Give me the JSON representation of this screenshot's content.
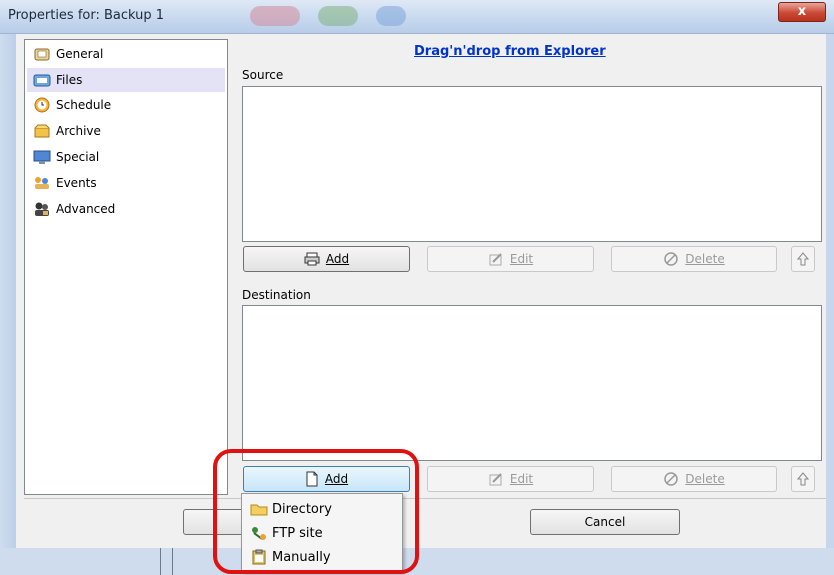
{
  "window": {
    "title": "Properties for: Backup 1",
    "close_label": "x"
  },
  "nav": {
    "items": [
      {
        "label": "General",
        "icon": "general-icon"
      },
      {
        "label": "Files",
        "icon": "files-icon",
        "selected": true
      },
      {
        "label": "Schedule",
        "icon": "schedule-icon"
      },
      {
        "label": "Archive",
        "icon": "archive-icon"
      },
      {
        "label": "Special",
        "icon": "special-icon"
      },
      {
        "label": "Events",
        "icon": "events-icon"
      },
      {
        "label": "Advanced",
        "icon": "advanced-icon"
      }
    ]
  },
  "files": {
    "dragdrop_link": "Drag'n'drop from Explorer",
    "source": {
      "label": "Source",
      "add_label": "Add",
      "edit_label": "Edit",
      "delete_label": "Delete"
    },
    "destination": {
      "label": "Destination",
      "add_label": "Add",
      "edit_label": "Edit",
      "delete_label": "Delete"
    }
  },
  "dialog": {
    "cancel_label": "Cancel"
  },
  "add_menu": {
    "items": [
      {
        "label": "Directory",
        "icon": "folder-icon"
      },
      {
        "label": "FTP site",
        "icon": "ftp-icon"
      },
      {
        "label": "Manually",
        "icon": "clipboard-icon"
      }
    ]
  },
  "colors": {
    "highlight": "#e11111",
    "link": "#0033cc",
    "selected_nav": "#e4e2f7"
  }
}
